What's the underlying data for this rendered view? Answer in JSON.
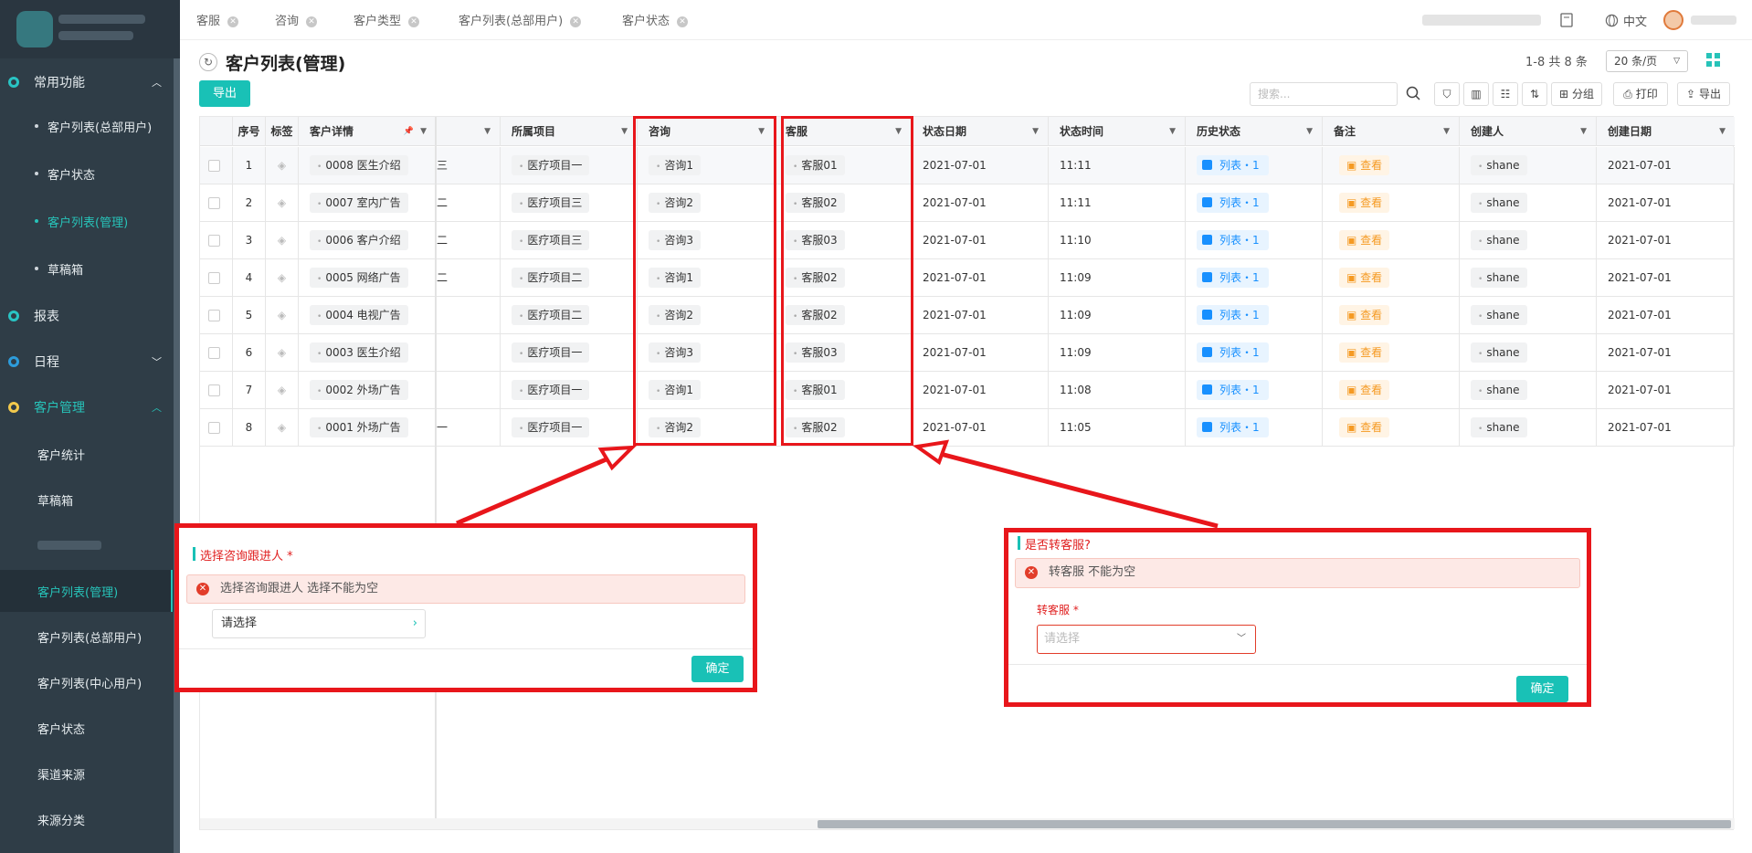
{
  "sidebar": {
    "groups": {
      "common": "常用功能",
      "report": "报表",
      "schedule": "日程",
      "customer_mgmt": "客户管理"
    },
    "common_items": [
      "客户列表(总部用户)",
      "客户状态",
      "客户列表(管理)",
      "草稿箱"
    ],
    "mgmt_items": [
      "客户统计",
      "草稿箱",
      "客户列表(管理)",
      "客户列表(总部用户)",
      "客户列表(中心用户)",
      "客户状态",
      "渠道来源",
      "来源分类"
    ]
  },
  "tabs": [
    "客服",
    "咨询",
    "客户类型",
    "客户列表(总部用户)",
    "客户状态"
  ],
  "topbar": {
    "language": "中文"
  },
  "page": {
    "title": "客户列表(管理)",
    "pager": "1-8 共 8 条",
    "page_size": "20 条/页",
    "export_label": "导出",
    "search_placeholder": "搜索...",
    "group_label": "分组",
    "print_label": "打印",
    "export_tool_label": "导出"
  },
  "table": {
    "headers": {
      "index": "序号",
      "label": "标签",
      "detail": "客户详情",
      "project": "所属项目",
      "consult": "咨询",
      "service": "客服",
      "status_date": "状态日期",
      "status_time": "状态时间",
      "history": "历史状态",
      "remark": "备注",
      "creator": "创建人",
      "create_date": "创建日期"
    },
    "rows": [
      {
        "idx": "1",
        "frag": "三",
        "detail": "0008 医生介绍",
        "project": "医疗项目一",
        "consult": "咨询1",
        "service": "客服01",
        "sdate": "2021-07-01",
        "stime": "11:11",
        "history": "列表・1",
        "remark": "查看",
        "creator": "shane",
        "cdate": "2021-07-01"
      },
      {
        "idx": "2",
        "frag": "二",
        "detail": "0007 室内广告",
        "project": "医疗项目三",
        "consult": "咨询2",
        "service": "客服02",
        "sdate": "2021-07-01",
        "stime": "11:11",
        "history": "列表・1",
        "remark": "查看",
        "creator": "shane",
        "cdate": "2021-07-01"
      },
      {
        "idx": "3",
        "frag": "二",
        "detail": "0006 客户介绍",
        "project": "医疗项目三",
        "consult": "咨询3",
        "service": "客服03",
        "sdate": "2021-07-01",
        "stime": "11:10",
        "history": "列表・1",
        "remark": "查看",
        "creator": "shane",
        "cdate": "2021-07-01"
      },
      {
        "idx": "4",
        "frag": "二",
        "detail": "0005 网络广告",
        "project": "医疗项目二",
        "consult": "咨询1",
        "service": "客服02",
        "sdate": "2021-07-01",
        "stime": "11:09",
        "history": "列表・1",
        "remark": "查看",
        "creator": "shane",
        "cdate": "2021-07-01"
      },
      {
        "idx": "5",
        "frag": "",
        "detail": "0004 电视广告",
        "project": "医疗项目二",
        "consult": "咨询2",
        "service": "客服02",
        "sdate": "2021-07-01",
        "stime": "11:09",
        "history": "列表・1",
        "remark": "查看",
        "creator": "shane",
        "cdate": "2021-07-01"
      },
      {
        "idx": "6",
        "frag": "",
        "detail": "0003 医生介绍",
        "project": "医疗项目一",
        "consult": "咨询3",
        "service": "客服03",
        "sdate": "2021-07-01",
        "stime": "11:09",
        "history": "列表・1",
        "remark": "查看",
        "creator": "shane",
        "cdate": "2021-07-01"
      },
      {
        "idx": "7",
        "frag": "",
        "detail": "0002 外场广告",
        "project": "医疗项目一",
        "consult": "咨询1",
        "service": "客服01",
        "sdate": "2021-07-01",
        "stime": "11:08",
        "history": "列表・1",
        "remark": "查看",
        "creator": "shane",
        "cdate": "2021-07-01"
      },
      {
        "idx": "8",
        "frag": "一",
        "detail": "0001 外场广告",
        "project": "医疗项目一",
        "consult": "咨询2",
        "service": "客服02",
        "sdate": "2021-07-01",
        "stime": "11:05",
        "history": "列表・1",
        "remark": "查看",
        "creator": "shane",
        "cdate": "2021-07-01"
      }
    ]
  },
  "dialog_consult": {
    "title": "选择咨询跟进人 *",
    "error": "选择咨询跟进人 选择不能为空",
    "select_value": "请选择",
    "ok": "确定"
  },
  "dialog_service": {
    "title": "是否转客服?",
    "error": "转客服 不能为空",
    "field_label": "转客服 *",
    "placeholder": "请选择",
    "ok": "确定"
  },
  "colors": {
    "accent": "#19c1b6",
    "annotation": "#e8161b",
    "sidebar_bg": "#2f3d47"
  }
}
